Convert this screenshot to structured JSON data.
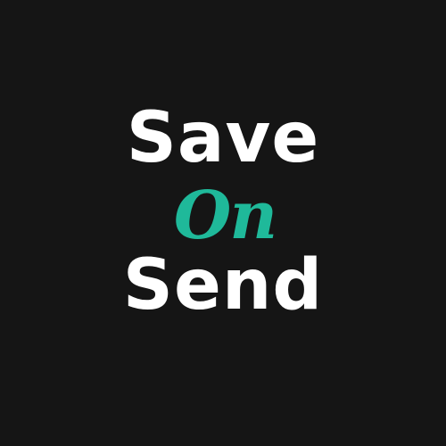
{
  "logo": {
    "line1": "Save",
    "line2": "On",
    "line3": "Send"
  },
  "colors": {
    "background": "#151515",
    "text_primary": "#ffffff",
    "accent": "#1fb99a"
  }
}
